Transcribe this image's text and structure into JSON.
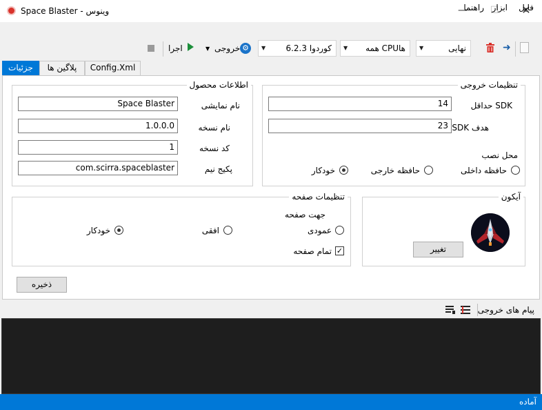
{
  "window": {
    "title": "Space Blaster - وینوس",
    "minimize": "—",
    "maximize": "☐",
    "close": "✕"
  },
  "menu": {
    "file": "فایل",
    "tools": "ابزار",
    "help": "راهنما"
  },
  "toolbar": {
    "build_type": "نهایی",
    "cpu": "همه CPUها",
    "cordova": "کوردوا 6.2.3",
    "output": "خروجی",
    "run": "اجرا"
  },
  "tabs": {
    "details": "جزئیات",
    "plugins": "پلاگین ها",
    "config": "Config.Xml"
  },
  "product_info": {
    "title": "اطلاعات محصول",
    "display_name_label": "نام نمایشی",
    "display_name": "Space Blaster",
    "version_name_label": "نام نسخه",
    "version_name": "1.0.0.0",
    "version_code_label": "کد نسخه",
    "version_code": "1",
    "package_name_label": "پکیج نیم",
    "package_name": "com.scirra.spaceblaster"
  },
  "output_settings": {
    "title": "تنظیمات خروجی",
    "min_sdk_label": "حداقل SDK",
    "min_sdk": "14",
    "target_sdk_label": "SDK هدف",
    "target_sdk": "23",
    "install_location_label": "محل نصب",
    "install_internal": "حافظه داخلی",
    "install_external": "حافظه خارجی",
    "install_auto": "خودکار",
    "install_selected": "auto"
  },
  "page_settings": {
    "title": "تنظیمات صفحه",
    "orientation_label": "جهت صفحه",
    "portrait": "عمودی",
    "landscape": "افقی",
    "auto": "خودکار",
    "orientation_selected": "auto",
    "fullscreen_label": "تمام صفحه",
    "fullscreen": true
  },
  "icon_box": {
    "title": "آیکون",
    "change_button": "تغییر"
  },
  "save_button": "ذخیره",
  "output_panel": {
    "title": "پیام های خروجی"
  },
  "status": {
    "text": "آماده"
  },
  "colors": {
    "accent": "#0078d7",
    "console_bg": "#1e1e1e",
    "run_green": "#1c8e3a",
    "delete_red": "#d9322b"
  },
  "icons": [
    "app-icon",
    "gear-icon",
    "play-icon",
    "stop-icon",
    "trash-icon",
    "arrow-right-icon",
    "file-icon",
    "list-icon",
    "list-clear-icon",
    "spaceship-icon"
  ]
}
